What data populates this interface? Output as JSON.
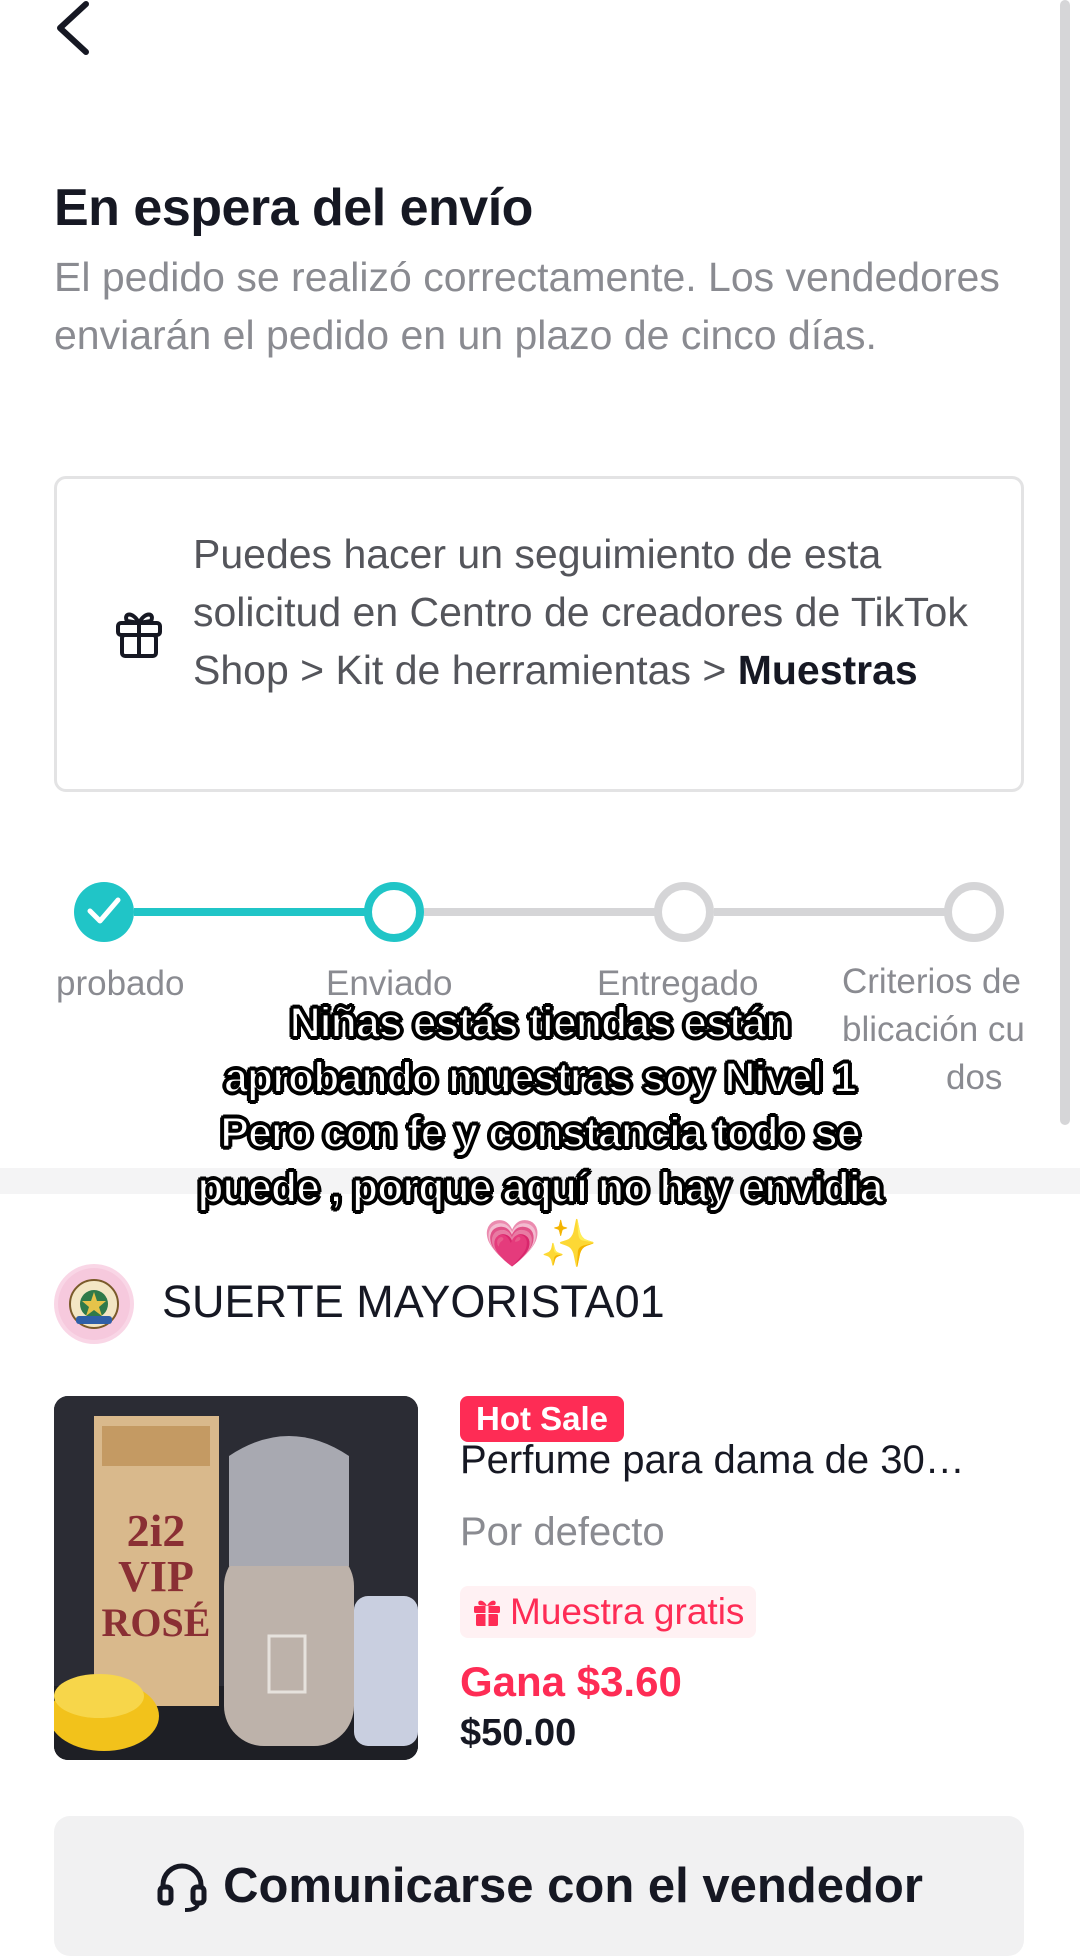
{
  "header": {
    "back_icon": "chevron-left-icon"
  },
  "status": {
    "title": "En espera del envío",
    "subtitle": "El pedido se realizó correctamente. Los vendedores enviarán el pedido en un plazo de cinco días."
  },
  "info": {
    "icon": "gift-icon",
    "text": "Puedes hacer un seguimiento de esta solicitud en Centro de creadores de TikTok Shop > Kit de herramientas > ",
    "bold": "Muestras"
  },
  "steps": {
    "s1": "probado",
    "s2": "Enviado",
    "s3": "Entregado",
    "s4a": "Criterios de",
    "s4b": "blicación cu",
    "s4c": "dos"
  },
  "overlay": {
    "line1": "Niñas estás tiendas están",
    "line2": "aprobando muestras soy Nivel 1",
    "line3": "Pero con fe y constancia todo se",
    "line4": "puede , porque aquí no hay envidia",
    "emoji": "💗✨"
  },
  "shop": {
    "name": "SUERTE MAYORISTA01"
  },
  "product": {
    "badge": "Hot Sale",
    "title": "Perfume para dama de 30…",
    "variant": "Por defecto",
    "sample_label": "Muestra gratis",
    "earn": "Gana $3.60",
    "price": "$50.00"
  },
  "contact": {
    "label": "Comunicarse con el vendedor",
    "icon": "headset-icon"
  },
  "colors": {
    "accent": "#20c5c7",
    "brand": "#fe2c55"
  }
}
